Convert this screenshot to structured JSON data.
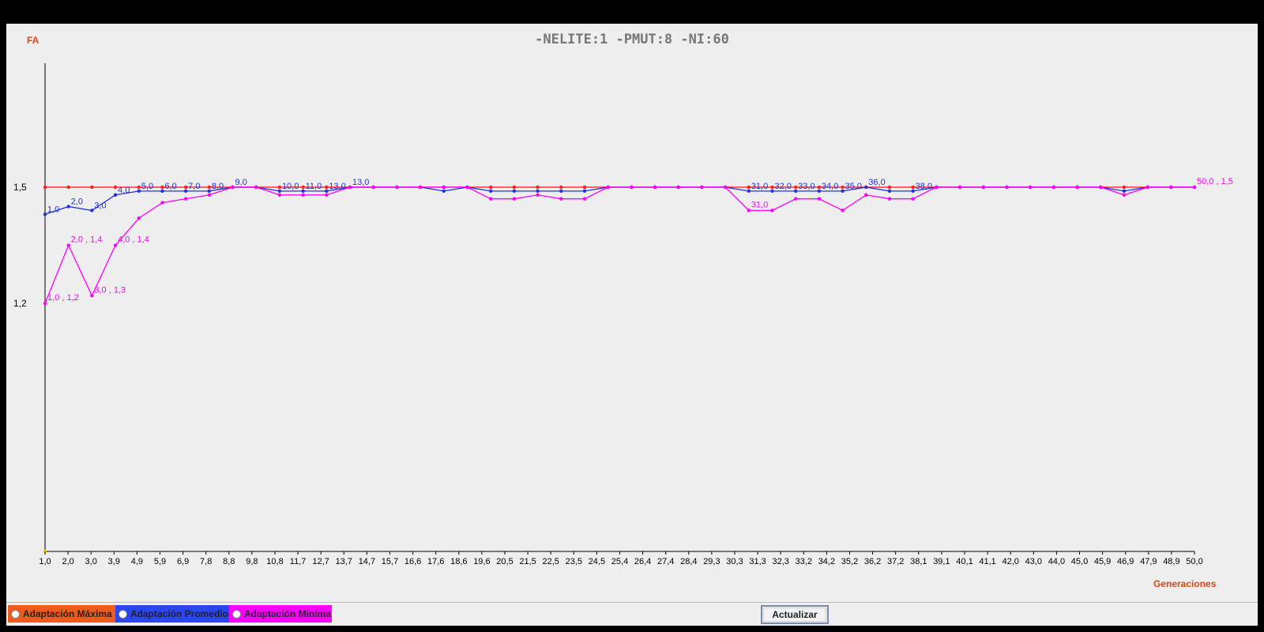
{
  "window": {
    "title": "-NELITE:1 -PMUT:8 -NI:60",
    "ylabel": "FA",
    "xlabel": "Generaciones",
    "button": "Actualizar"
  },
  "legend": [
    {
      "label": "Adaptación Máxima",
      "color": "#f05a1a"
    },
    {
      "label": "Adaptación Promedio",
      "color": "#2a46f0"
    },
    {
      "label": "Adaptación Mínima",
      "color": "#ff00ff"
    }
  ],
  "chart_data": {
    "type": "line",
    "title": "-NELITE:1 -PMUT:8 -NI:60",
    "ylabel": "FA",
    "xlabel": "Generaciones",
    "x_tick_labels": [
      "1,0",
      "2,0",
      "3,0",
      "3,9",
      "4,9",
      "5,9",
      "6,9",
      "7,8",
      "8,8",
      "9,8",
      "10,8",
      "11,7",
      "12,7",
      "13,7",
      "14,7",
      "15,7",
      "16,6",
      "17,6",
      "18,6",
      "19,6",
      "20,5",
      "21,5",
      "22,5",
      "23,5",
      "24,5",
      "25,4",
      "26,4",
      "27,4",
      "28,4",
      "29,3",
      "30,3",
      "31,3",
      "32,3",
      "33,2",
      "34,2",
      "35,2",
      "36,2",
      "37,2",
      "38,1",
      "39,1",
      "40,1",
      "41,1",
      "42,0",
      "43,0",
      "44,0",
      "45,0",
      "45,9",
      "46,9",
      "47,9",
      "48,9",
      "50,0"
    ],
    "y_ticks": [
      {
        "value": 1.2,
        "label": "1,2"
      },
      {
        "value": 1.5,
        "label": "1,5"
      }
    ],
    "xlim": [
      1,
      50
    ],
    "ylim": [
      0.56,
      1.82
    ],
    "series": [
      {
        "name": "Adaptación Máxima",
        "color": "#ff2020",
        "x": [
          1,
          2,
          3,
          4,
          5,
          6,
          7,
          8,
          9,
          10,
          11,
          12,
          13,
          14,
          15,
          16,
          17,
          18,
          19,
          20,
          21,
          22,
          23,
          24,
          25,
          26,
          27,
          28,
          29,
          30,
          31,
          32,
          33,
          34,
          35,
          36,
          37,
          38,
          39,
          40,
          41,
          42,
          43,
          44,
          45,
          46,
          47,
          48,
          49,
          50
        ],
        "y": [
          1.5,
          1.5,
          1.5,
          1.5,
          1.5,
          1.5,
          1.5,
          1.5,
          1.5,
          1.5,
          1.5,
          1.5,
          1.5,
          1.5,
          1.5,
          1.5,
          1.5,
          1.5,
          1.5,
          1.5,
          1.5,
          1.5,
          1.5,
          1.5,
          1.5,
          1.5,
          1.5,
          1.5,
          1.5,
          1.5,
          1.5,
          1.5,
          1.5,
          1.5,
          1.5,
          1.5,
          1.5,
          1.5,
          1.5,
          1.5,
          1.5,
          1.5,
          1.5,
          1.5,
          1.5,
          1.5,
          1.5,
          1.5,
          1.5,
          1.5
        ]
      },
      {
        "name": "Adaptación Promedio",
        "color": "#2233dd",
        "x": [
          1,
          2,
          3,
          4,
          5,
          6,
          7,
          8,
          9,
          10,
          11,
          12,
          13,
          14,
          15,
          16,
          17,
          18,
          19,
          20,
          21,
          22,
          23,
          24,
          25,
          26,
          27,
          28,
          29,
          30,
          31,
          32,
          33,
          34,
          35,
          36,
          37,
          38,
          39,
          40,
          41,
          42,
          43,
          44,
          45,
          46,
          47,
          48,
          49,
          50
        ],
        "y": [
          1.43,
          1.45,
          1.44,
          1.48,
          1.49,
          1.49,
          1.49,
          1.49,
          1.5,
          1.5,
          1.49,
          1.49,
          1.49,
          1.5,
          1.5,
          1.5,
          1.5,
          1.49,
          1.5,
          1.49,
          1.49,
          1.49,
          1.49,
          1.49,
          1.5,
          1.5,
          1.5,
          1.5,
          1.5,
          1.5,
          1.49,
          1.49,
          1.49,
          1.49,
          1.49,
          1.5,
          1.49,
          1.49,
          1.5,
          1.5,
          1.5,
          1.5,
          1.5,
          1.5,
          1.5,
          1.5,
          1.49,
          1.5,
          1.5,
          1.5
        ],
        "point_labels": [
          "1,0",
          "2,0",
          "3,0",
          "4,0",
          "5,0",
          "6,0",
          "7,0",
          "8,0",
          "9,0",
          "",
          "10,0",
          "11,0",
          "13,0",
          "13,0",
          "",
          "",
          "",
          "",
          "",
          "",
          "",
          "",
          "",
          "",
          "",
          "",
          "",
          "",
          "",
          "",
          "31,0",
          "32,0",
          "33,0",
          "34,0",
          "35,0",
          "36,0",
          "",
          "38,0",
          "",
          "",
          "",
          "",
          "",
          "",
          "",
          "",
          "",
          "",
          "",
          ""
        ]
      },
      {
        "name": "Adaptación Mínima",
        "color": "#ff00ff",
        "x": [
          1,
          2,
          3,
          4,
          5,
          6,
          7,
          8,
          9,
          10,
          11,
          12,
          13,
          14,
          15,
          16,
          17,
          18,
          19,
          20,
          21,
          22,
          23,
          24,
          25,
          26,
          27,
          28,
          29,
          30,
          31,
          32,
          33,
          34,
          35,
          36,
          37,
          38,
          39,
          40,
          41,
          42,
          43,
          44,
          45,
          46,
          47,
          48,
          49,
          50
        ],
        "y": [
          1.2,
          1.35,
          1.22,
          1.35,
          1.42,
          1.46,
          1.47,
          1.48,
          1.5,
          1.5,
          1.48,
          1.48,
          1.48,
          1.5,
          1.5,
          1.5,
          1.5,
          1.5,
          1.5,
          1.47,
          1.47,
          1.48,
          1.47,
          1.47,
          1.5,
          1.5,
          1.5,
          1.5,
          1.5,
          1.5,
          1.44,
          1.44,
          1.47,
          1.47,
          1.44,
          1.48,
          1.47,
          1.47,
          1.5,
          1.5,
          1.5,
          1.5,
          1.5,
          1.5,
          1.5,
          1.5,
          1.48,
          1.5,
          1.5,
          1.5
        ],
        "point_labels": [
          "1,0 , 1,2",
          "2,0 , 1,4",
          "3,0 , 1,3",
          "4,0 , 1,4",
          "",
          "",
          "",
          "",
          "",
          "",
          "",
          "",
          "",
          "",
          "",
          "",
          "",
          "",
          "",
          "",
          "",
          "",
          "",
          "",
          "",
          "",
          "",
          "",
          "",
          "",
          "31,0",
          "",
          "",
          "",
          "",
          "",
          "",
          "",
          "",
          "",
          "",
          "",
          "",
          "",
          "",
          "",
          "",
          "",
          "",
          "50,0 , 1,5"
        ]
      }
    ],
    "grid": false,
    "legend_position": "bottom-left"
  }
}
